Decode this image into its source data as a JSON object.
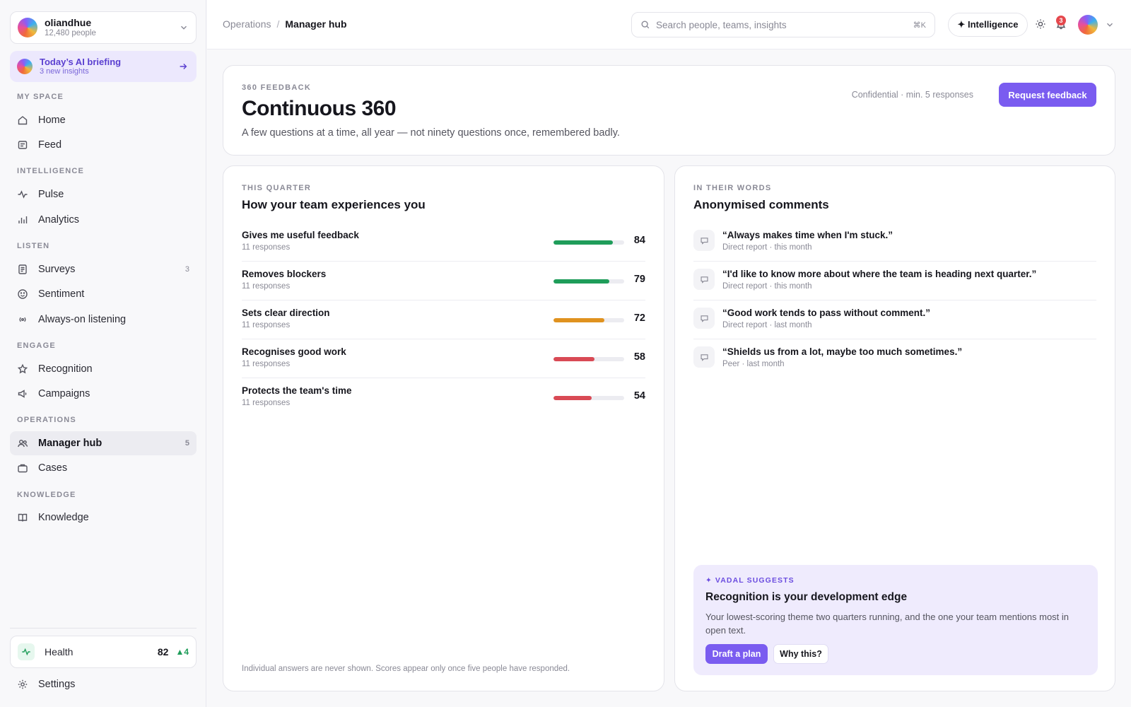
{
  "org": {
    "name": "oliandhue",
    "people": "12,480 people"
  },
  "briefing": {
    "title": "Today’s AI briefing",
    "sub": "3 new insights"
  },
  "nav": {
    "sections": [
      "MY SPACE",
      "INTELLIGENCE",
      "LISTEN",
      "ENGAGE",
      "OPERATIONS",
      "KNOWLEDGE"
    ],
    "items": [
      {
        "label": "Home",
        "icon": "home-icon",
        "count": ""
      },
      {
        "label": "Feed",
        "icon": "feed-icon",
        "count": ""
      },
      {
        "label": "Pulse",
        "icon": "pulse-icon",
        "count": ""
      },
      {
        "label": "Analytics",
        "icon": "bar-chart-icon",
        "count": ""
      },
      {
        "label": "Surveys",
        "icon": "document-icon",
        "count": "3"
      },
      {
        "label": "Sentiment",
        "icon": "smiley-icon",
        "count": ""
      },
      {
        "label": "Always-on listening",
        "icon": "broadcast-icon",
        "count": ""
      },
      {
        "label": "Recognition",
        "icon": "star-icon",
        "count": ""
      },
      {
        "label": "Campaigns",
        "icon": "megaphone-icon",
        "count": ""
      },
      {
        "label": "Manager hub",
        "icon": "users-icon",
        "count": "5"
      },
      {
        "label": "Cases",
        "icon": "briefcase-icon",
        "count": ""
      },
      {
        "label": "Knowledge",
        "icon": "book-icon",
        "count": ""
      }
    ]
  },
  "health": {
    "label": "Health",
    "score": "82",
    "delta": "▲4"
  },
  "settings": {
    "label": "Settings"
  },
  "topbar": {
    "crumb_parent": "Operations",
    "crumb_sep": "/",
    "crumb_current": "Manager hub",
    "search_placeholder": "Search people, teams, insights",
    "search_shortcut": "⌘K",
    "intelligence_label": "✦ Intelligence",
    "notifications": "3"
  },
  "hero": {
    "eyebrow": "360 FEEDBACK",
    "title": "Continuous 360",
    "subtitle": "A few questions at a time, all year — not ninety questions once, remembered badly.",
    "meta": "Confidential · min. 5 responses",
    "button": "Request feedback"
  },
  "scores": {
    "eyebrow": "THIS QUARTER",
    "title": "How your team experiences you",
    "items": [
      {
        "label": "Gives me useful feedback",
        "sub": "11 responses",
        "score": "84",
        "fraction": 0.84,
        "color": "#1f9d5a"
      },
      {
        "label": "Removes blockers",
        "sub": "11 responses",
        "score": "79",
        "fraction": 0.79,
        "color": "#1f9d5a"
      },
      {
        "label": "Sets clear direction",
        "sub": "11 responses",
        "score": "72",
        "fraction": 0.72,
        "color": "#e0921f"
      },
      {
        "label": "Recognises good work",
        "sub": "11 responses",
        "score": "58",
        "fraction": 0.58,
        "color": "#d94a55"
      },
      {
        "label": "Protects the team's time",
        "sub": "11 responses",
        "score": "54",
        "fraction": 0.54,
        "color": "#d94a55"
      }
    ],
    "footnote": "Individual answers are never shown. Scores appear only once five people have responded."
  },
  "comments": {
    "eyebrow": "IN THEIR WORDS",
    "title": "Anonymised comments",
    "items": [
      {
        "quote": "“Always makes time when I'm stuck.”",
        "meta": "Direct report · this month"
      },
      {
        "quote": "“I'd like to know more about where the team is heading next quarter.”",
        "meta": "Direct report · this month"
      },
      {
        "quote": "“Good work tends to pass without comment.”",
        "meta": "Direct report · last month"
      },
      {
        "quote": "“Shields us from a lot, maybe too much sometimes.”",
        "meta": "Peer · last month"
      }
    ]
  },
  "suggestion": {
    "eyebrow": "✦ VADAL SUGGESTS",
    "title": "Recognition is your development edge",
    "body": "Your lowest-scoring theme two quarters running, and the one your team mentions most in open text.",
    "primary": "Draft a plan",
    "secondary": "Why this?"
  }
}
